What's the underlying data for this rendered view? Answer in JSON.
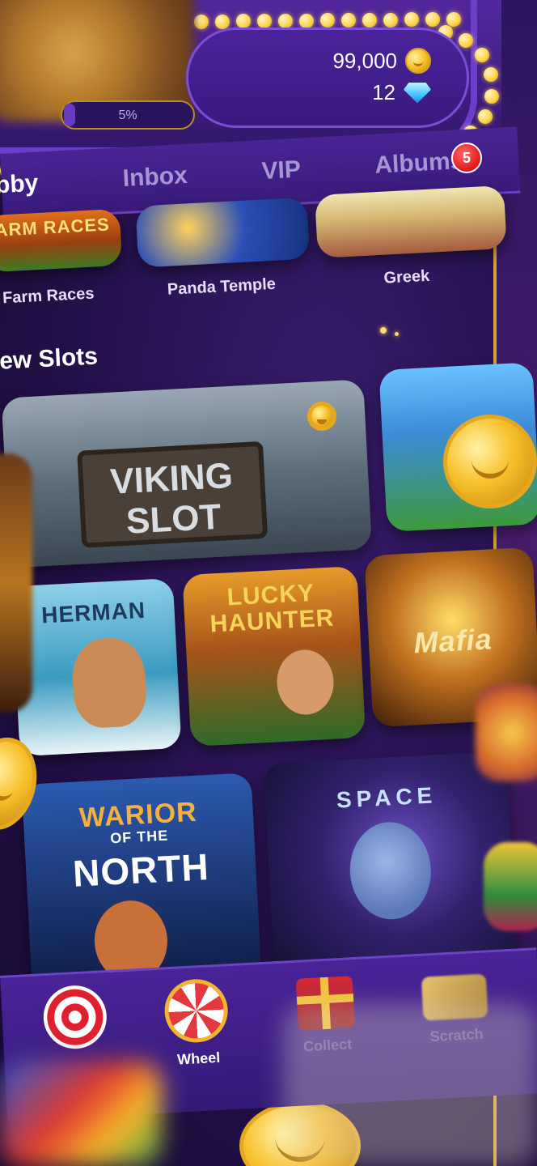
{
  "header": {
    "coins": "99,000",
    "gems": "12",
    "level_progress": "5%",
    "level_progress_value": 0.05
  },
  "tabs": [
    {
      "label": "bby",
      "active": true
    },
    {
      "label": "Inbox",
      "active": false
    },
    {
      "label": "VIP",
      "active": false
    },
    {
      "label": "Albums",
      "active": false,
      "badge": "5"
    }
  ],
  "top_row_games": [
    {
      "label": "Farm Races",
      "art_text": "ARM RACES"
    },
    {
      "label": "Panda Temple",
      "art_text": ""
    },
    {
      "label": "Greek",
      "art_text": ""
    }
  ],
  "new_slots": {
    "title": "ew Slots",
    "games": [
      {
        "name": "viking",
        "line1": "VIKING",
        "line2": "SLOT"
      },
      {
        "name": "green-castle",
        "line1": "",
        "line2": ""
      },
      {
        "name": "fisherman",
        "line1": "HERMAN",
        "line2": ""
      },
      {
        "name": "lucky-haunter",
        "line1": "LUCKY",
        "line2": "HAUNTER"
      },
      {
        "name": "mafia",
        "line1": "Mafia",
        "line2": ""
      },
      {
        "name": "warior-north",
        "line1": "WARIOR",
        "line2": "OF THE",
        "line3": "NORTH"
      },
      {
        "name": "space",
        "line1": "SPACE",
        "line2": ""
      }
    ]
  },
  "bottom_nav": [
    {
      "label": "",
      "icon": "target-icon"
    },
    {
      "label": "Wheel",
      "icon": "wheel-icon"
    },
    {
      "label": "Collect",
      "icon": "gift-icon"
    },
    {
      "label": "Scratch",
      "icon": "scratch-ticket-icon"
    }
  ],
  "colors": {
    "background": "#24104a",
    "accent_gold": "#f7c02b",
    "badge_red": "#e01717",
    "panel_purple": "#4a239a"
  }
}
